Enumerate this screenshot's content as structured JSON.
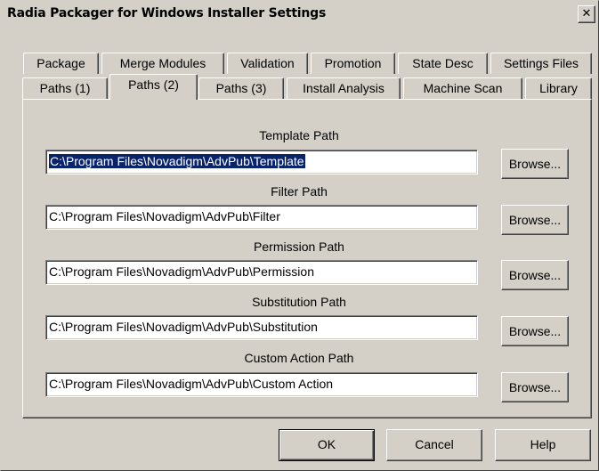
{
  "window": {
    "title": "Radia Packager for Windows Installer Settings",
    "close_glyph": "✕"
  },
  "tabs": {
    "row_back": [
      "Package",
      "Merge Modules",
      "Validation",
      "Promotion",
      "State Desc",
      "Settings Files"
    ],
    "row_front": [
      "Paths (1)",
      "Paths (2)",
      "Paths (3)",
      "Install Analysis",
      "Machine Scan",
      "Library"
    ],
    "active": "Paths (2)"
  },
  "paths": [
    {
      "label": "Template Path",
      "value": "C:\\Program Files\\Novadigm\\AdvPub\\Template",
      "selected": true,
      "browse": "Browse..."
    },
    {
      "label": "Filter Path",
      "value": "C:\\Program Files\\Novadigm\\AdvPub\\Filter",
      "selected": false,
      "browse": "Browse..."
    },
    {
      "label": "Permission Path",
      "value": "C:\\Program Files\\Novadigm\\AdvPub\\Permission",
      "selected": false,
      "browse": "Browse..."
    },
    {
      "label": "Substitution Path",
      "value": "C:\\Program Files\\Novadigm\\AdvPub\\Substitution",
      "selected": false,
      "browse": "Browse..."
    },
    {
      "label": "Custom Action Path",
      "value": "C:\\Program Files\\Novadigm\\AdvPub\\Custom Action",
      "selected": false,
      "browse": "Browse..."
    }
  ],
  "buttons": {
    "ok": "OK",
    "cancel": "Cancel",
    "help": "Help"
  },
  "colors": {
    "face": "#d4d0c8",
    "selection": "#0a246a"
  }
}
